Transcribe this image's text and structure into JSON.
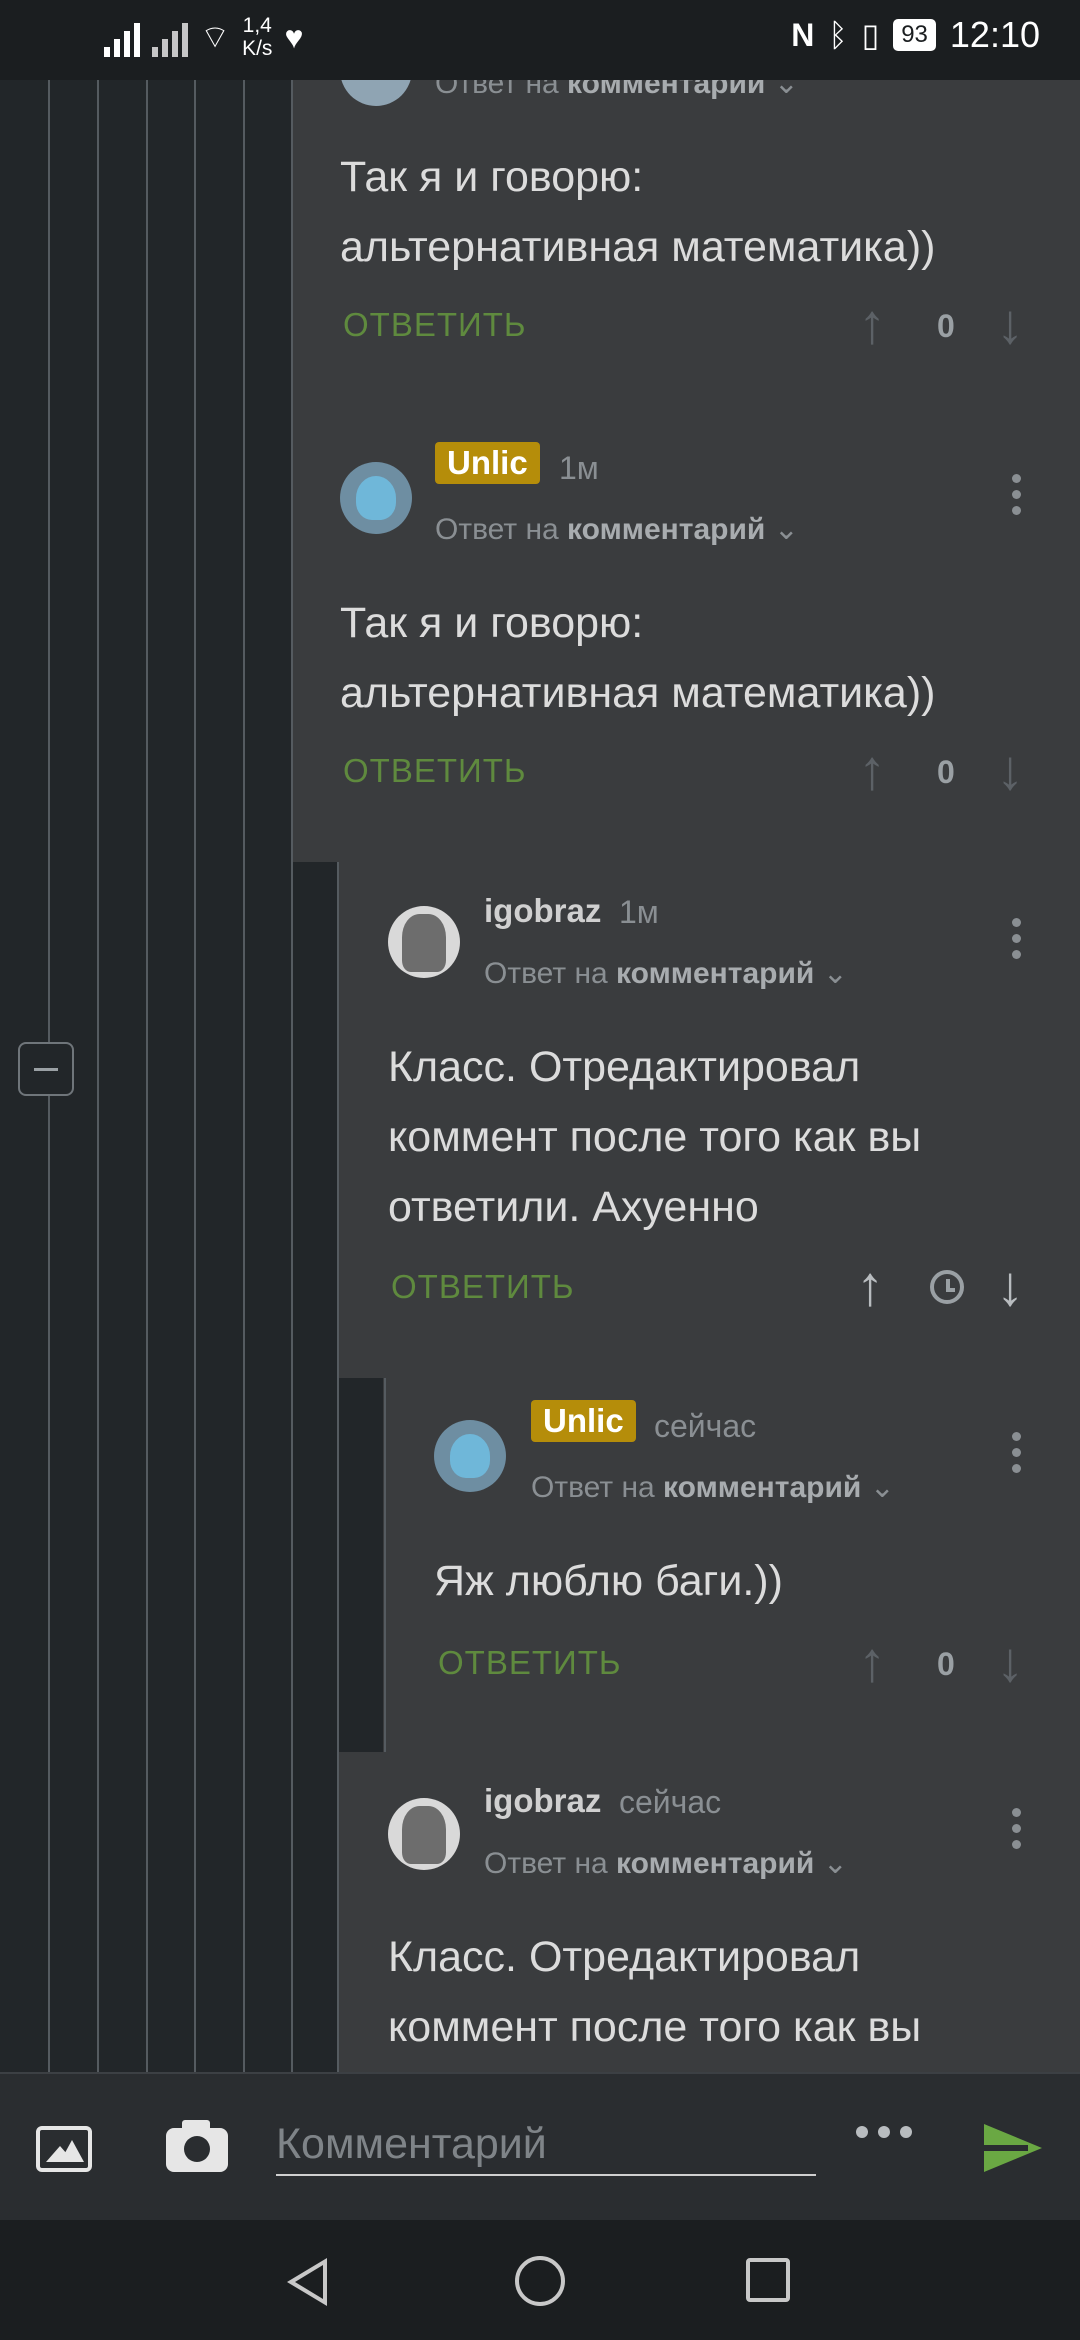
{
  "status_bar": {
    "net_speed_value": "1,4",
    "net_speed_unit": "K/s",
    "battery": "93",
    "time": "12:10",
    "icons": [
      "signal-icon",
      "signal-x-icon",
      "wifi-icon",
      "heart-health-icon",
      "nfc-icon",
      "bluetooth-icon",
      "vibrate-icon",
      "battery-icon"
    ]
  },
  "comments": [
    {
      "reply_to_prefix": "Ответ на",
      "reply_to_target": "комментарий",
      "text_line1": "Так я и говорю:",
      "text_line2": "альтернативная математика))",
      "reply_label": "ОТВЕТИТЬ",
      "votes": "0"
    },
    {
      "username": "Unlic",
      "time": "1м",
      "reply_to_prefix": "Ответ на",
      "reply_to_target": "комментарий",
      "text_line1": "Так я и говорю:",
      "text_line2": "альтернативная математика))",
      "reply_label": "ОТВЕТИТЬ",
      "votes": "0"
    },
    {
      "username": "igobraz",
      "time": "1м",
      "reply_to_prefix": "Ответ на",
      "reply_to_target": "комментарий",
      "text_line1": "Класс. Отредактировал",
      "text_line2": "коммент после того как вы",
      "text_line3": "ответили. Ахуенно",
      "reply_label": "ОТВЕТИТЬ"
    },
    {
      "username": "Unlic",
      "time": "сейчас",
      "reply_to_prefix": "Ответ на",
      "reply_to_target": "комментарий",
      "text_line1": "Яж люблю баги.))",
      "reply_label": "ОТВЕТИТЬ",
      "votes": "0"
    },
    {
      "username": "igobraz",
      "time": "сейчас",
      "reply_to_prefix": "Ответ на",
      "reply_to_target": "комментарий",
      "text_line1": "Класс. Отредактировал",
      "text_line2": "коммент после того как вы"
    }
  ],
  "composer": {
    "placeholder": "Комментарий"
  },
  "colors": {
    "badge": "#b58d0a",
    "reply_green": "#5f8a3e",
    "send_green": "#6aa843",
    "comment_bg": "#3a3c3e",
    "thread_bg": "#222629"
  }
}
